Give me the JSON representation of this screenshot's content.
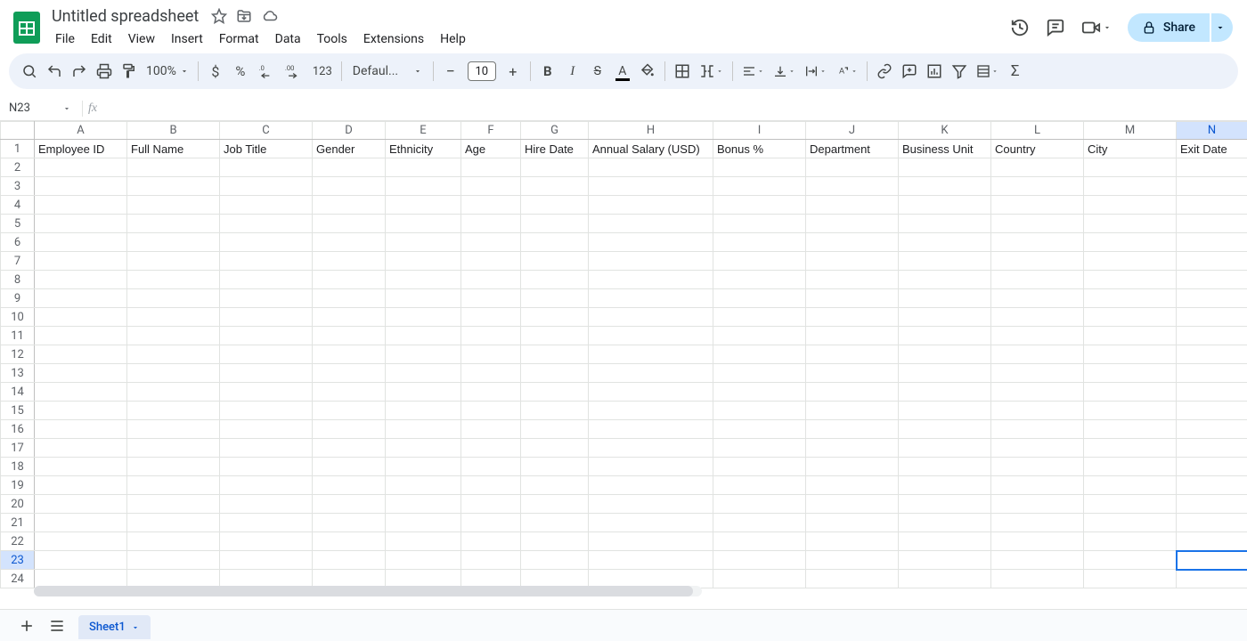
{
  "doc": {
    "title": "Untitled spreadsheet"
  },
  "menus": [
    "File",
    "Edit",
    "View",
    "Insert",
    "Format",
    "Data",
    "Tools",
    "Extensions",
    "Help"
  ],
  "share": {
    "label": "Share"
  },
  "toolbar": {
    "zoom": "100%",
    "fmt123": "123",
    "font": "Defaul...",
    "fontsize": "10"
  },
  "namebox": "N23",
  "columns": [
    "A",
    "B",
    "C",
    "D",
    "E",
    "F",
    "G",
    "H",
    "I",
    "J",
    "K",
    "L",
    "M",
    "N"
  ],
  "header_row": [
    "Employee ID",
    "Full Name",
    "Job Title",
    "Gender",
    "Ethnicity",
    "Age",
    "Hire Date",
    "Annual Salary (USD)",
    "Bonus %",
    "Department",
    "Business Unit",
    "Country",
    "City",
    "Exit Date"
  ],
  "row_count": 24,
  "selection": {
    "col": "N",
    "row": 23
  },
  "sheets": {
    "active": "Sheet1"
  }
}
